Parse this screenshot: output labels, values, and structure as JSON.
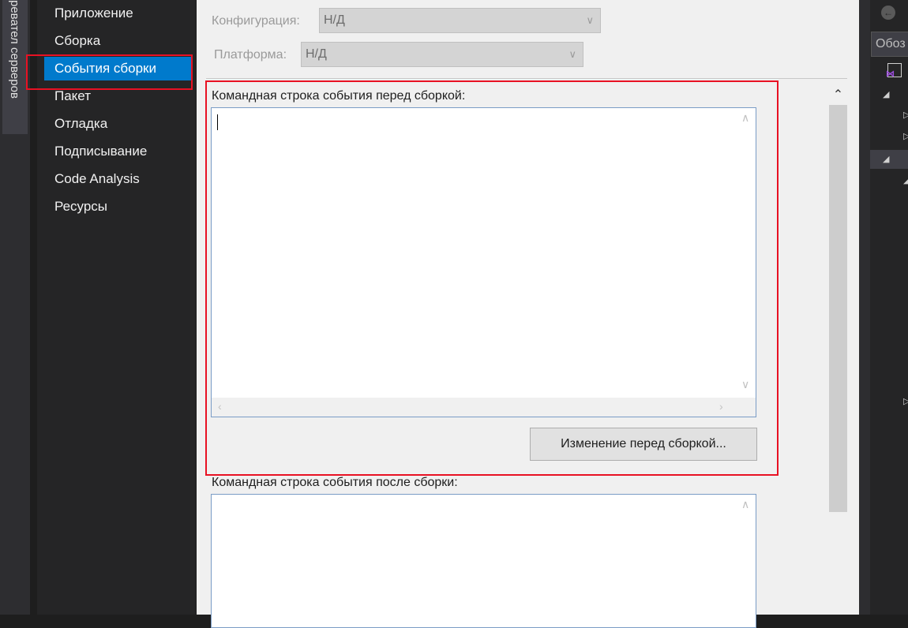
{
  "server_explorer_tab": {
    "label": "ревател серверов"
  },
  "nav": {
    "items": [
      {
        "label": "Приложение"
      },
      {
        "label": "Сборка"
      },
      {
        "label": "События сборки",
        "selected": true
      },
      {
        "label": "Пакет"
      },
      {
        "label": "Отладка"
      },
      {
        "label": "Подписывание"
      },
      {
        "label": "Code Analysis"
      },
      {
        "label": "Ресурсы"
      }
    ]
  },
  "config": {
    "configuration_label": "Конфигурация:",
    "configuration_value": "Н/Д",
    "platform_label": "Платформа:",
    "platform_value": "Н/Д"
  },
  "prebuild": {
    "label": "Командная строка события перед сборкой:",
    "value": "",
    "edit_button": "Изменение перед сборкой..."
  },
  "postbuild": {
    "label": "Командная строка события после сборки:",
    "value": ""
  },
  "right_panel": {
    "search_placeholder": "Обоз"
  },
  "colors": {
    "selection": "#007acc",
    "highlight_border": "#e81123",
    "editor_background": "#f0f0f0",
    "dark_panel": "#252526"
  },
  "icons": [
    "back-arrow-icon",
    "expand-triangle-icon",
    "collapse-triangle-icon",
    "vs-project-icon",
    "chevron-down-icon",
    "chevron-up-icon",
    "chevron-left-icon",
    "chevron-right-icon"
  ]
}
